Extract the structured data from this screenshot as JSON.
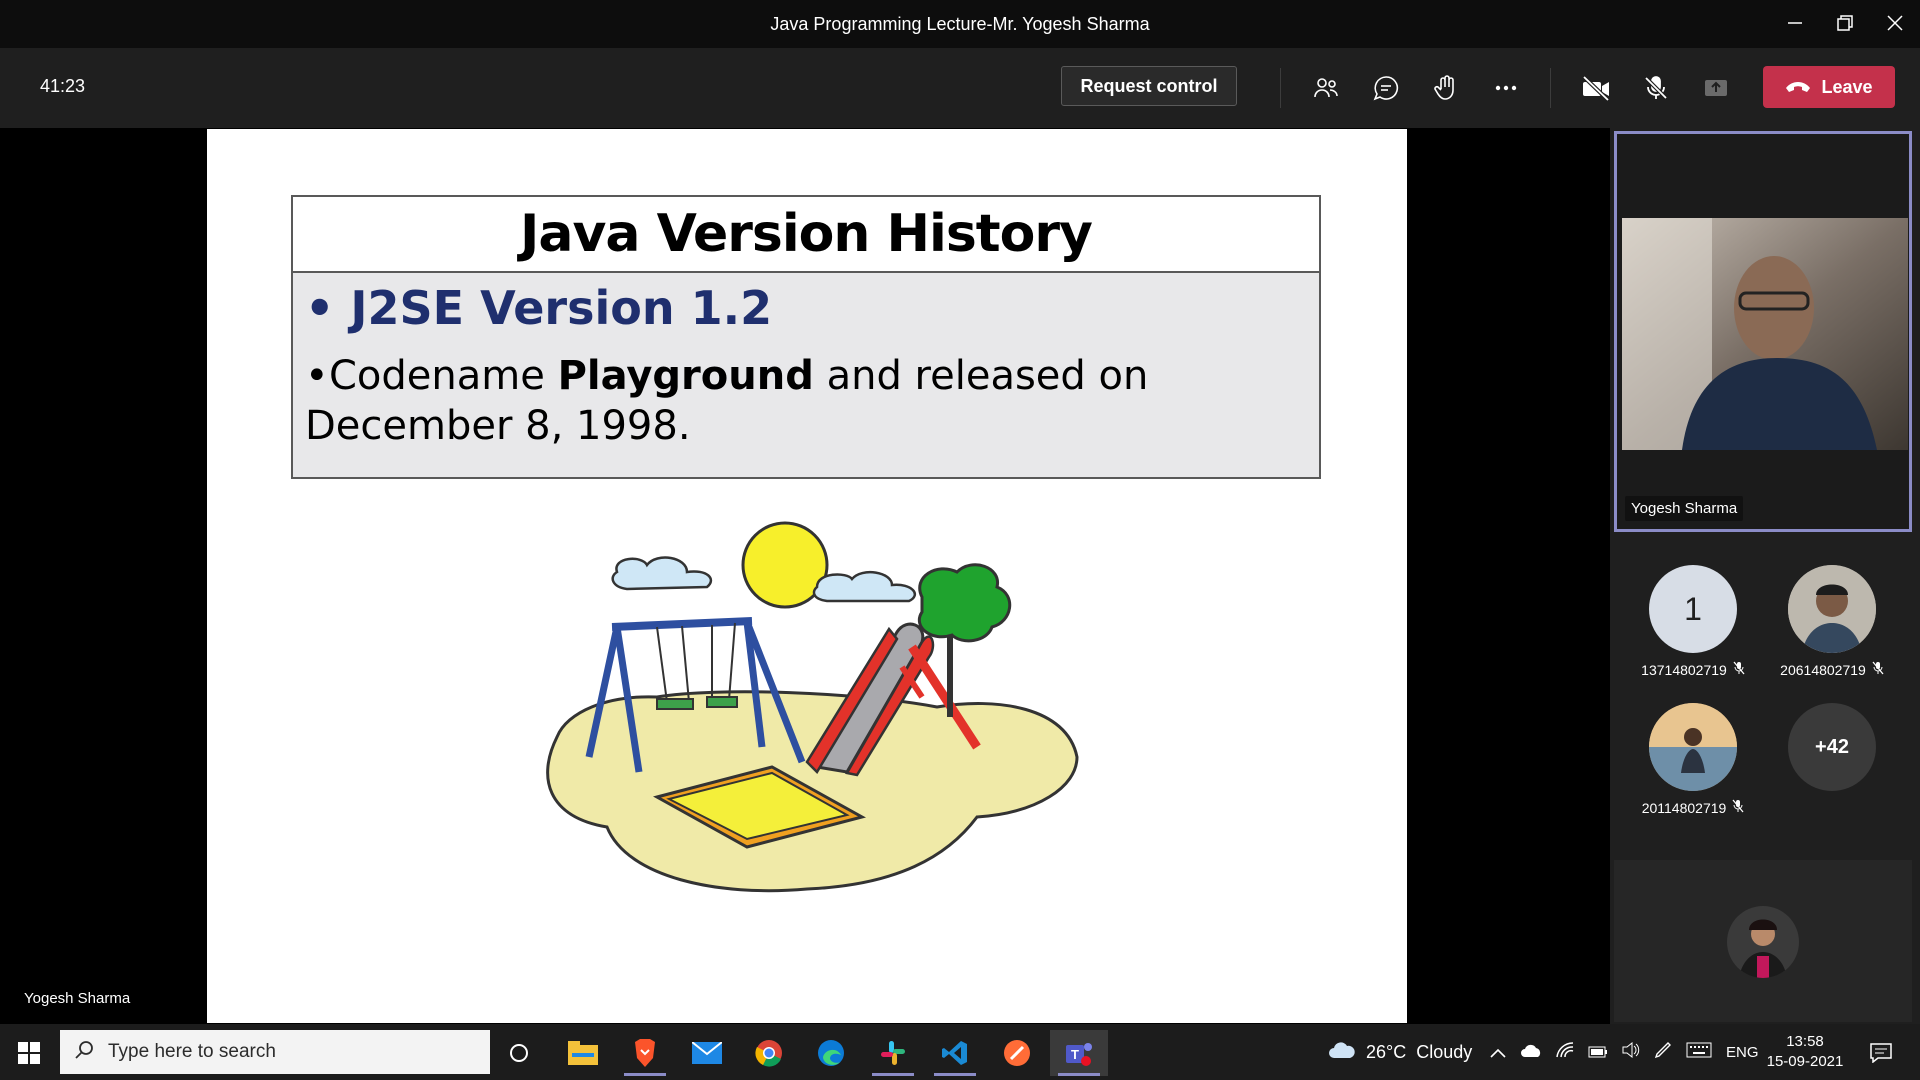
{
  "window": {
    "title": "Java Programming Lecture-Mr. Yogesh Sharma"
  },
  "toolbar": {
    "timer": "41:23",
    "request_control_label": "Request control",
    "leave_label": "Leave"
  },
  "slide": {
    "title": "Java Version History",
    "bullet1": "J2SE Version 1.2",
    "bullet2_pre": "Codename ",
    "bullet2_bold": "Playground",
    "bullet2_post": " and released on December 8, 1998."
  },
  "stage": {
    "presenter_name": "Yogesh Sharma"
  },
  "spotlight": {
    "name": "Yogesh Sharma"
  },
  "participants": [
    {
      "initial": "1",
      "name": "13714802719"
    },
    {
      "name": "20614802719"
    },
    {
      "name": "20114802719"
    }
  ],
  "overflow": {
    "label": "+42"
  },
  "taskbar": {
    "search_placeholder": "Type here to search",
    "weather": "26°C  Cloudy",
    "lang": "ENG",
    "time": "13:58",
    "date": "15-09-2021"
  },
  "colors": {
    "leave": "#c4314b",
    "accent": "#8b8cc7",
    "slide_blue": "#1f2f6e"
  }
}
